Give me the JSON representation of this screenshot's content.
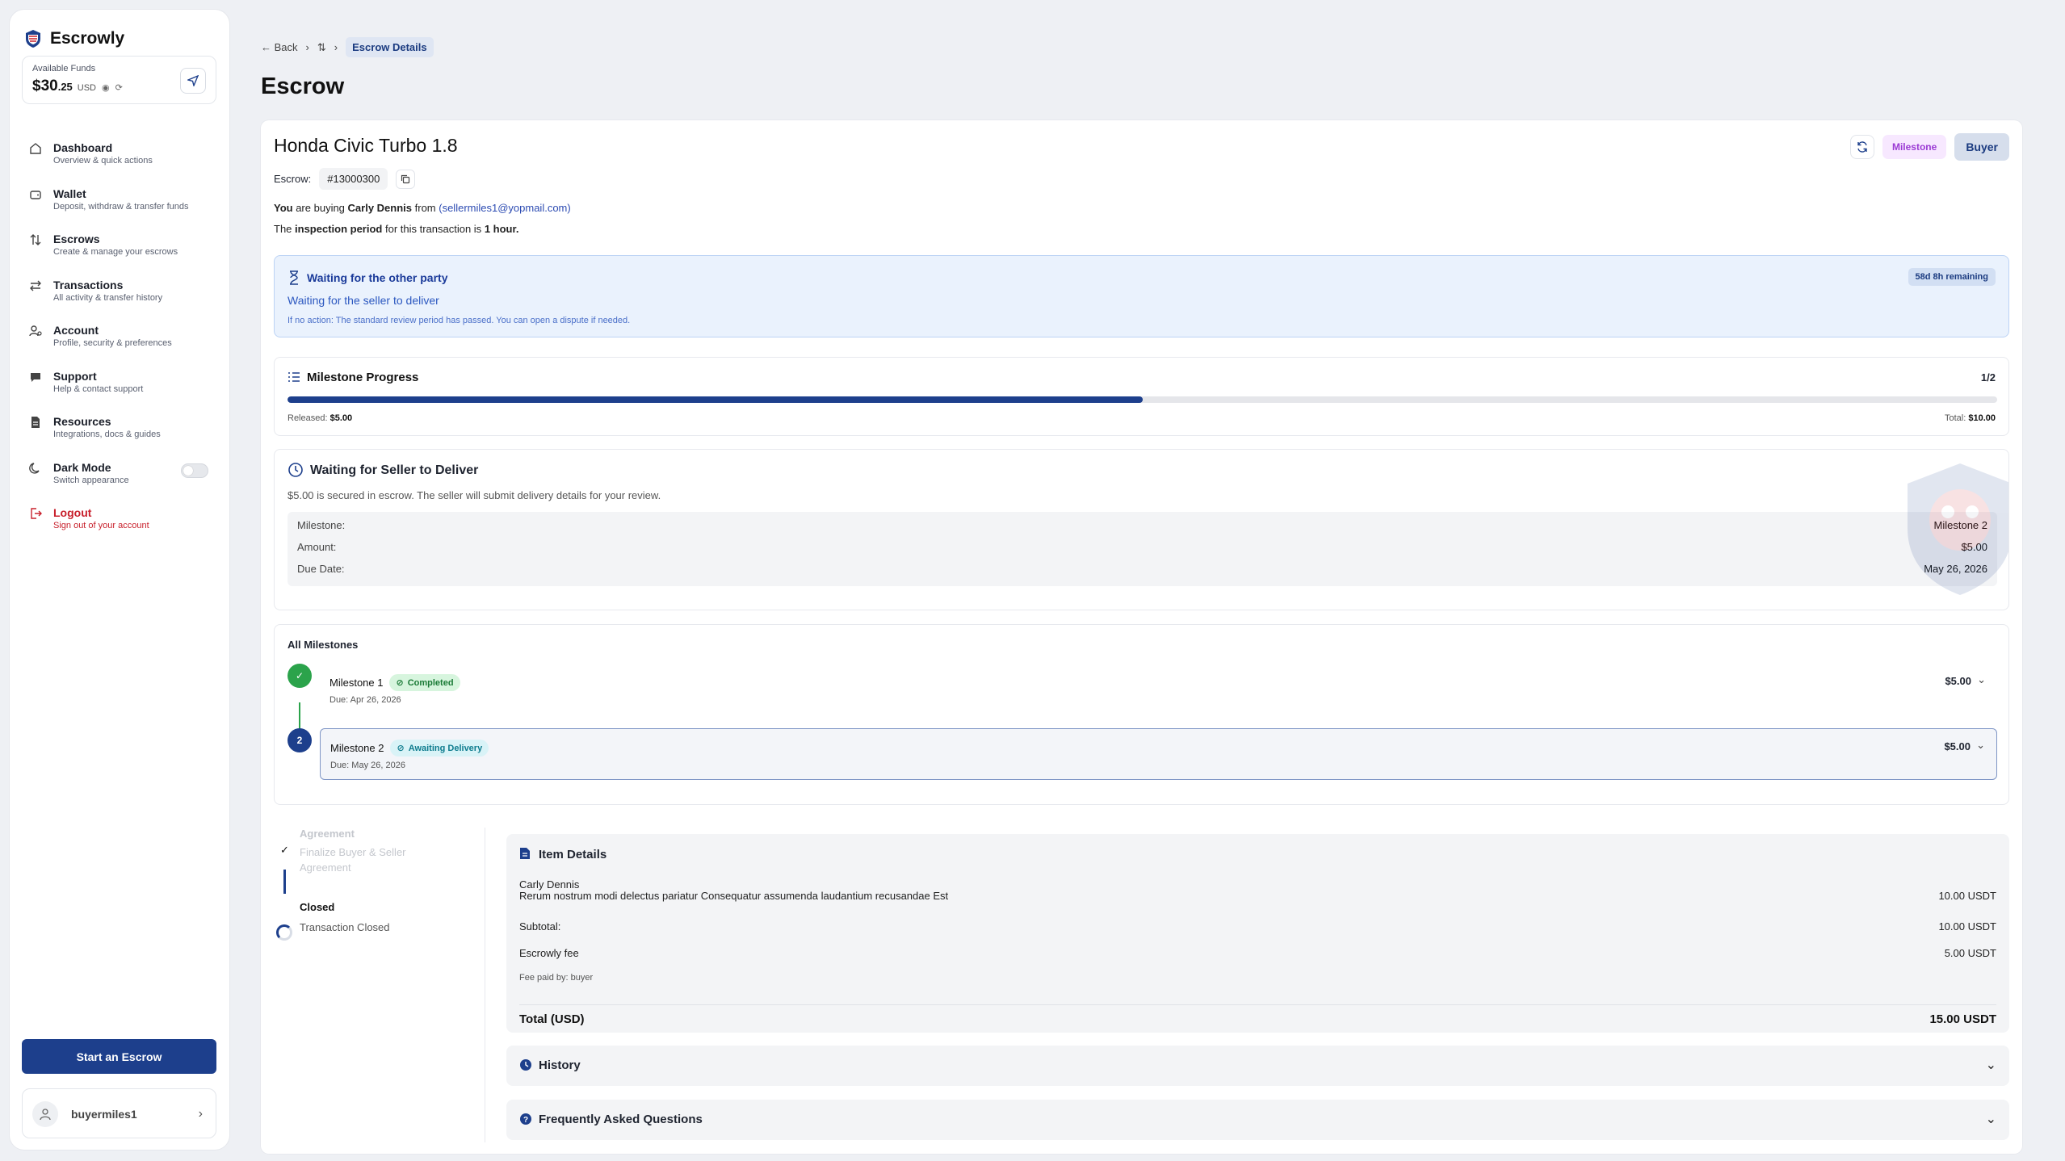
{
  "brand": {
    "name": "Escrowly"
  },
  "funds": {
    "label": "Available Funds",
    "amount": "$30",
    "cents": ".25",
    "currency": "USD"
  },
  "nav": [
    {
      "title": "Dashboard",
      "sub": "Overview & quick actions",
      "icon": "home-icon"
    },
    {
      "title": "Wallet",
      "sub": "Deposit, withdraw & transfer funds",
      "icon": "wallet-icon"
    },
    {
      "title": "Escrows",
      "sub": "Create & manage your escrows",
      "icon": "arrows-updown-icon"
    },
    {
      "title": "Transactions",
      "sub": "All activity & transfer history",
      "icon": "transfer-icon"
    },
    {
      "title": "Account",
      "sub": "Profile, security & preferences",
      "icon": "user-settings-icon"
    },
    {
      "title": "Support",
      "sub": "Help & contact support",
      "icon": "chat-icon"
    },
    {
      "title": "Resources",
      "sub": "Integrations, docs & guides",
      "icon": "document-icon"
    },
    {
      "title": "Dark Mode",
      "sub": "Switch appearance",
      "icon": "moon-icon"
    },
    {
      "title": "Logout",
      "sub": "Sign out of your account",
      "icon": "logout-icon"
    }
  ],
  "start_button": "Start an Escrow",
  "user": {
    "name": "buyermiles1"
  },
  "breadcrumb": {
    "back": "Back",
    "current": "Escrow Details"
  },
  "page_title": "Escrow",
  "escrow": {
    "title": "Honda Civic Turbo 1.8",
    "tag_milestone": "Milestone",
    "tag_role": "Buyer",
    "id_label": "Escrow:",
    "id": "#13000300",
    "buying_you": "You",
    "buying_mid": " are buying ",
    "buying_name": "Carly Dennis",
    "buying_from": " from ",
    "buying_email": "(sellermiles1@yopmail.com)",
    "insp_pre": "The ",
    "insp_bold": "inspection period",
    "insp_mid": " for this transaction is ",
    "insp_val": "1 hour."
  },
  "waiting": {
    "title": "Waiting for the other party",
    "subtitle": "Waiting for the seller to deliver",
    "note": "If no action: The standard review period has passed. You can open a dispute if needed.",
    "remaining": "58d 8h remaining"
  },
  "progress": {
    "title": "Milestone Progress",
    "fraction": "1/2",
    "percent": 50,
    "released_label": "Released:",
    "released": "$5.00",
    "total_label": "Total:",
    "total": "$10.00"
  },
  "deliver": {
    "title": "Waiting for Seller to Deliver",
    "desc": "$5.00 is secured in escrow. The seller will submit delivery details for your review.",
    "rows": [
      {
        "label": "Milestone:",
        "value": "Milestone 2"
      },
      {
        "label": "Amount:",
        "value": "$5.00"
      },
      {
        "label": "Due Date:",
        "value": "May 26, 2026"
      }
    ]
  },
  "milestones": {
    "title": "All Milestones",
    "items": [
      {
        "name": "Milestone 1",
        "status": "Completed",
        "due": "Due: Apr 26, 2026",
        "amount": "$5.00",
        "num": "✓"
      },
      {
        "name": "Milestone 2",
        "status": "Awaiting Delivery",
        "due": "Due: May 26, 2026",
        "amount": "$5.00",
        "num": "2"
      }
    ]
  },
  "steps": {
    "s1_title": "Agreement",
    "s1_desc": "Finalize Buyer & Seller Agreement",
    "s2_title": "Closed",
    "s2_desc": "Transaction Closed"
  },
  "items": {
    "title": "Item Details",
    "seller": "Carly Dennis",
    "description": "Rerum nostrum modi delectus pariatur Consequatur assumenda laudantium recusandae Est",
    "price": "10.00 USDT",
    "subtotal_label": "Subtotal:",
    "subtotal": "10.00 USDT",
    "fee_label": "Escrowly fee",
    "fee": "5.00 USDT",
    "fee_paid": "Fee paid by: buyer",
    "total_label": "Total (USD)",
    "total": "15.00 USDT"
  },
  "history": {
    "title": "History"
  },
  "faq": {
    "title": "Frequently Asked Questions"
  },
  "colors": {
    "primary": "#1d3f8c",
    "success": "#2ba34b",
    "danger": "#c8202c"
  }
}
